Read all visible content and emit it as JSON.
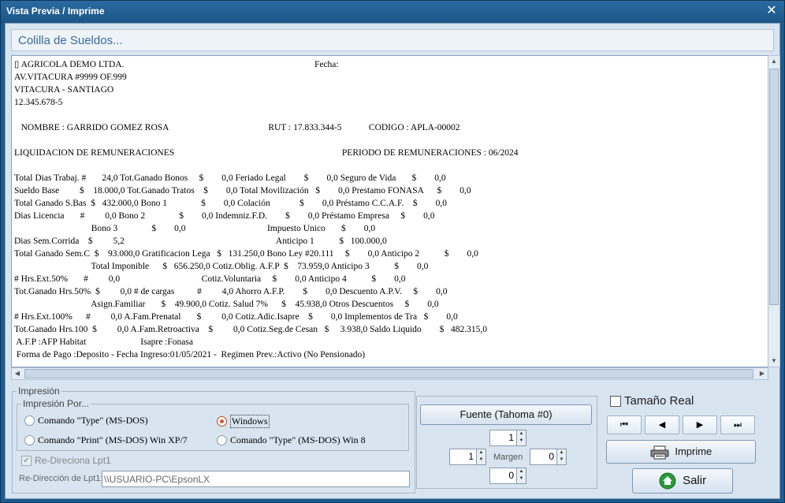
{
  "window": {
    "title": "Vista Previa / Imprime"
  },
  "header": {
    "title": "Colilla de Sueldos..."
  },
  "preview": {
    "lines": [
      "▯ AGRICOLA DEMO LTDA.                                                                                    Fecha:",
      "AV.VITACURA #9999 OF.999",
      "VITACURA - SANTIAGO",
      "12.345.678-5",
      "",
      "   NOMBRE : GARRIDO GOMEZ ROSA                                            RUT : 17.833.344-5            CODIGO : APLA-00002",
      "",
      "LIQUIDACION DE REMUNERACIONES                                                                          PERIODO DE REMUNERACIONES : 06/2024",
      "",
      "Total Dias Trabaj. #       24,0 Tot.Ganado Bonos     $        0,0 Feriado Legal        $        0,0 Seguro de Vida       $        0,0",
      "Sueldo Base         $    18.000,0 Tot.Ganado Tratos    $        0,0 Total Movilización   $        0,0 Prestamo FONASA      $        0,0",
      "Total Ganado S.Bas  $   432.000,0 Bono 1               $        0,0 Colación             $        0,0 Préstamo C.C.A.F.    $        0,0",
      "Dias Licencia       #         0,0 Bono 2               $        0,0 Indemniz.F.D.        $        0,0 Préstamo Empresa     $        0,0",
      "                                  Bono 3               $        0,0                                    Impuesto Unico       $        0,0",
      "Dias Sem.Corrida    $         5,2                                                                   Anticipo 1           $   100.000,0",
      "Total Ganado Sem.C  $    93.000,0 Gratificacion Lega   $   131.250,0 Bono Ley #20.111     $        0,0 Anticipo 2           $        0,0",
      "                                  Total Imponible      $   656.250,0 Cotiz.Oblig. A.F.P  $    73.959,0 Anticipo 3           $        0,0",
      "# Hrs.Ext.50%       #         0,0                                    Cotiz.Voluntaria     $        0,0 Anticipo 4           $        0,0",
      "Tot.Ganado Hrs.50%  $         0,0 # de cargas          #         4,0 Ahorro A.F.P.        $        0,0 Descuento A.P.V.     $        0,0",
      "                                  Asign.Familiar       $    49.900,0 Cotiz. Salud 7%      $    45.938,0 Otros Descuentos     $        0,0",
      "# Hrs.Ext.100%      #         0,0 A.Fam.Prenatal       $         0,0 Cotiz.Adic.Isapre    $        0,0 Implementos de Tra   $        0,0",
      "Tot.Ganado Hrs.100  $         0,0 A.Fam.Retroactiva    $         0,0 Cotiz.Seg.de Cesan   $     3.938,0 Saldo Liquido        $   482.315,0",
      " A.F.P :AFP Habitat                        Isapre :Fonasa",
      " Forma de Pago :Deposito - Fecha Ingreso:01/05/2021 -  Regimen Prev.:Activo (No Pensionado)"
    ]
  },
  "impresion": {
    "group_label": "Impresión",
    "subgroup_label": "Impresión Por...",
    "options": [
      {
        "label": "Comando \"Type\" (MS-DOS)",
        "selected": false
      },
      {
        "label": "Windows",
        "selected": true
      },
      {
        "label": "Comando \"Print\" (MS-DOS) Win XP/7",
        "selected": false
      },
      {
        "label": "Comando \"Type\" (MS-DOS) Win 8",
        "selected": false
      }
    ],
    "redirect_label": "Re-Direciona Lpt1",
    "redirect_checked": true,
    "redirect_field_label": "Re-Dirección de Lpt1:",
    "redirect_value": "\\\\USUARIO-PC\\EpsonLX"
  },
  "font_panel": {
    "font_button": "Fuente (Tahoma #0)",
    "margin_label": "Margen",
    "margin_top": "1",
    "margin_left": "1",
    "margin_right": "0",
    "margin_bottom": "0"
  },
  "controls": {
    "real_size_label": "Tamaño Real",
    "real_size_checked": false,
    "print_label": "Imprime",
    "exit_label": "Salir"
  }
}
